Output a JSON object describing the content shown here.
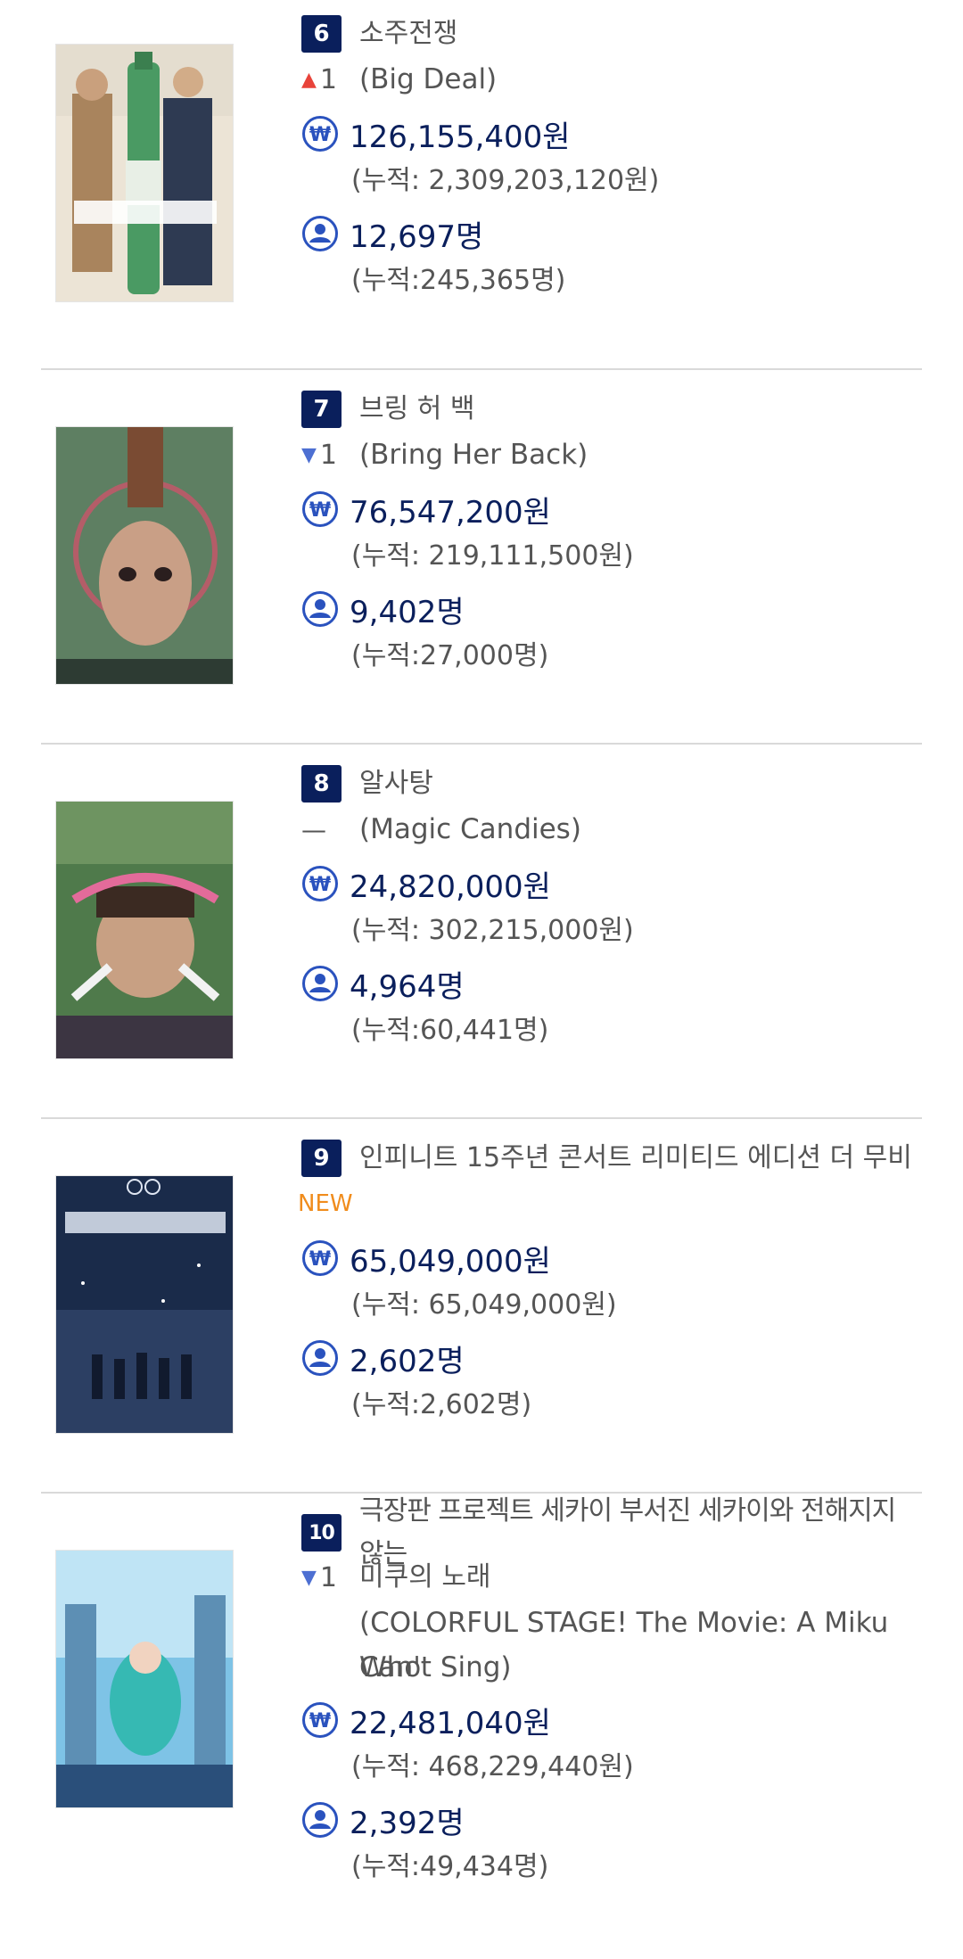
{
  "colors": {
    "rank_bg": "#0a1f5c",
    "value_text": "#0a1f5c",
    "up_arrow": "#e8433a",
    "down_arrow": "#4d6fd2",
    "new_badge": "#f08c1c",
    "divider": "#d9d9d9"
  },
  "movies": [
    {
      "rank": "6",
      "title": "소주전쟁",
      "change": "1",
      "change_dir": "up",
      "original": "(Big Deal)",
      "sales": "126,155,400원",
      "sales_total": "(누적: 2,309,203,120원)",
      "audience": "12,697명",
      "audience_total": "(누적:245,365명)"
    },
    {
      "rank": "7",
      "title": "브링 허 백",
      "change": "1",
      "change_dir": "down",
      "original": "(Bring Her Back)",
      "sales": "76,547,200원",
      "sales_total": "(누적: 219,111,500원)",
      "audience": "9,402명",
      "audience_total": "(누적:27,000명)"
    },
    {
      "rank": "8",
      "title": "알사탕",
      "change": "—",
      "change_dir": "same",
      "original": "(Magic Candies)",
      "sales": "24,820,000원",
      "sales_total": "(누적: 302,215,000원)",
      "audience": "4,964명",
      "audience_total": "(누적:60,441명)"
    },
    {
      "rank": "9",
      "title": "인피니트 15주년 콘서트 리미티드 에디션 더 무비",
      "change": "NEW",
      "change_dir": "new",
      "original": "",
      "sales": "65,049,000원",
      "sales_total": "(누적: 65,049,000원)",
      "audience": "2,602명",
      "audience_total": "(누적:2,602명)"
    },
    {
      "rank": "10",
      "title_line1": "극장판 프로젝트 세카이 부서진 세카이와 전해지지 않는",
      "title_line2": "미쿠의 노래",
      "change": "1",
      "change_dir": "down",
      "original_line1": "(COLORFUL STAGE! The Movie: A Miku Who",
      "original_line2": "Can't Sing)",
      "sales": "22,481,040원",
      "sales_total": "(누적: 468,229,440원)",
      "audience": "2,392명",
      "audience_total": "(누적:49,434명)"
    }
  ]
}
